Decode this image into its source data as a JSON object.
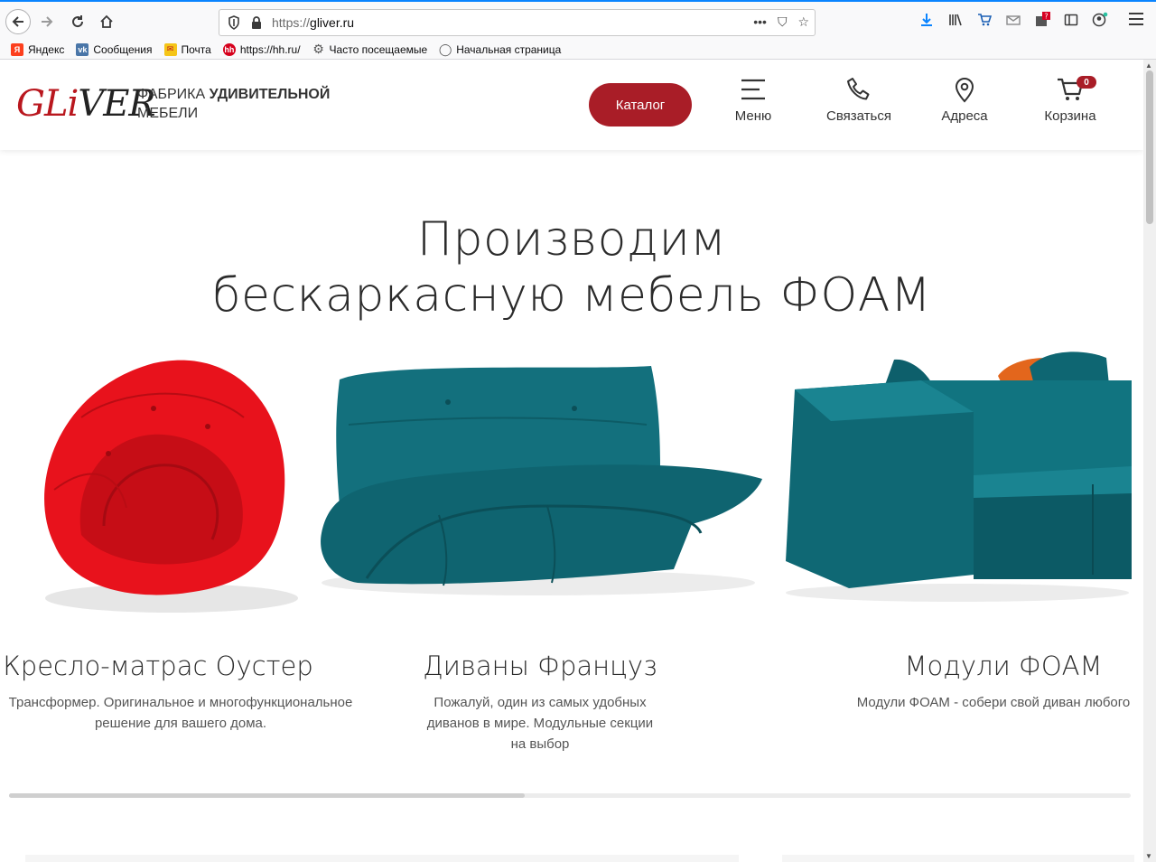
{
  "browser": {
    "url_prefix": "https://",
    "url_domain": "gliver.ru",
    "actions": [
      "•••",
      "⛉",
      "☆"
    ],
    "bookmarks": [
      {
        "label": "Яндекс",
        "icon": "yandex-icon",
        "icon_text": "Я",
        "color": "#fc3f1d"
      },
      {
        "label": "Сообщения",
        "icon": "vk-icon",
        "icon_text": "vk",
        "color": "#4a76a8"
      },
      {
        "label": "Почта",
        "icon": "mail-icon",
        "icon_text": "✉",
        "color": "#f5c518"
      },
      {
        "label": "https://hh.ru/",
        "icon": "hh-icon",
        "icon_text": "hh",
        "color": "#d6001c"
      },
      {
        "label": "Часто посещаемые",
        "icon": "gear-icon",
        "icon_text": "⚙",
        "color": "#555555"
      },
      {
        "label": "Начальная страница",
        "icon": "globe-icon",
        "icon_text": "◯",
        "color": "#555555"
      }
    ]
  },
  "header": {
    "logo_g": "GLi",
    "logo_v": "VER",
    "tagline_plain": "Фабрика ",
    "tagline_bold": "удивительной",
    "tagline_second": "мебели",
    "catalog_label": "Каталог",
    "nav": [
      {
        "label": "Меню",
        "icon": "menu-icon"
      },
      {
        "label": "Связаться",
        "icon": "phone-icon"
      },
      {
        "label": "Адреса",
        "icon": "location-icon"
      },
      {
        "label": "Корзина",
        "icon": "cart-icon"
      }
    ],
    "cart_count": "0"
  },
  "hero": {
    "line1": "Производим",
    "line2": "бескаркасную мебель ФОАМ"
  },
  "cards": [
    {
      "title": "Кресло-матрас Оустер",
      "desc": [
        "Трансформер. Оригинальное и многофункциональное",
        "решение для вашего дома."
      ]
    },
    {
      "title": "Диваны Француз",
      "desc": [
        "Пожалуй, один из самых удобных",
        "диванов в мире. Модульные секции",
        "на выбор"
      ]
    },
    {
      "title": "Модули ФОАМ",
      "desc": [
        "Модули ФОАМ - собери свой диван любого"
      ]
    }
  ],
  "colors": {
    "brand": "#a91d27",
    "teal": "#0f6470",
    "red_chair": "#e8121c",
    "orange_pillow": "#e3661c"
  },
  "carousel_progress": 0.46
}
